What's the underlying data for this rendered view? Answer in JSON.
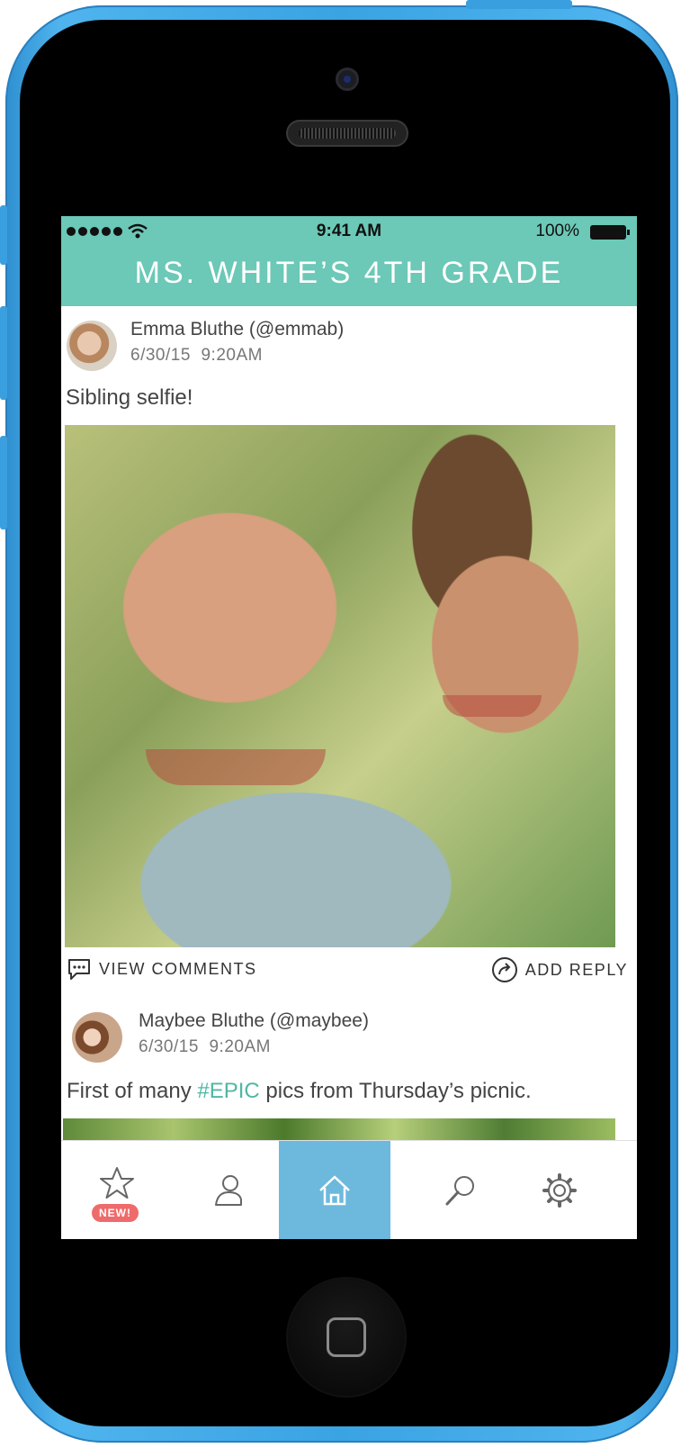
{
  "status_bar": {
    "time": "9:41 AM",
    "battery": "100%"
  },
  "header": {
    "title": "MS. WHITE’S 4TH GRADE"
  },
  "posts": [
    {
      "author": "Emma Bluthe (@emmab)",
      "date": "6/30/15",
      "time": "9:20AM",
      "text": "Sibling selfie!",
      "actions": {
        "view_comments": "VIEW COMMENTS",
        "add_reply": "ADD REPLY"
      }
    },
    {
      "author": "Maybee Bluthe (@maybee)",
      "date": "6/30/15",
      "time": "9:20AM",
      "text_before": "First of many ",
      "hashtag": "#EPIC",
      "text_after": " pics from Thursday’s picnic."
    }
  ],
  "tabbar": {
    "items": [
      {
        "icon": "star-icon",
        "badge": "NEW!"
      },
      {
        "icon": "profile-icon"
      },
      {
        "icon": "home-icon",
        "active": true
      },
      {
        "icon": "search-icon"
      },
      {
        "icon": "gear-icon"
      }
    ]
  },
  "colors": {
    "header": "#6cc8b7",
    "active_tab": "#6cb9dd",
    "badge": "#ef6a6a",
    "hashtag": "#4fb7a3",
    "phone": "#3aa3e2"
  }
}
